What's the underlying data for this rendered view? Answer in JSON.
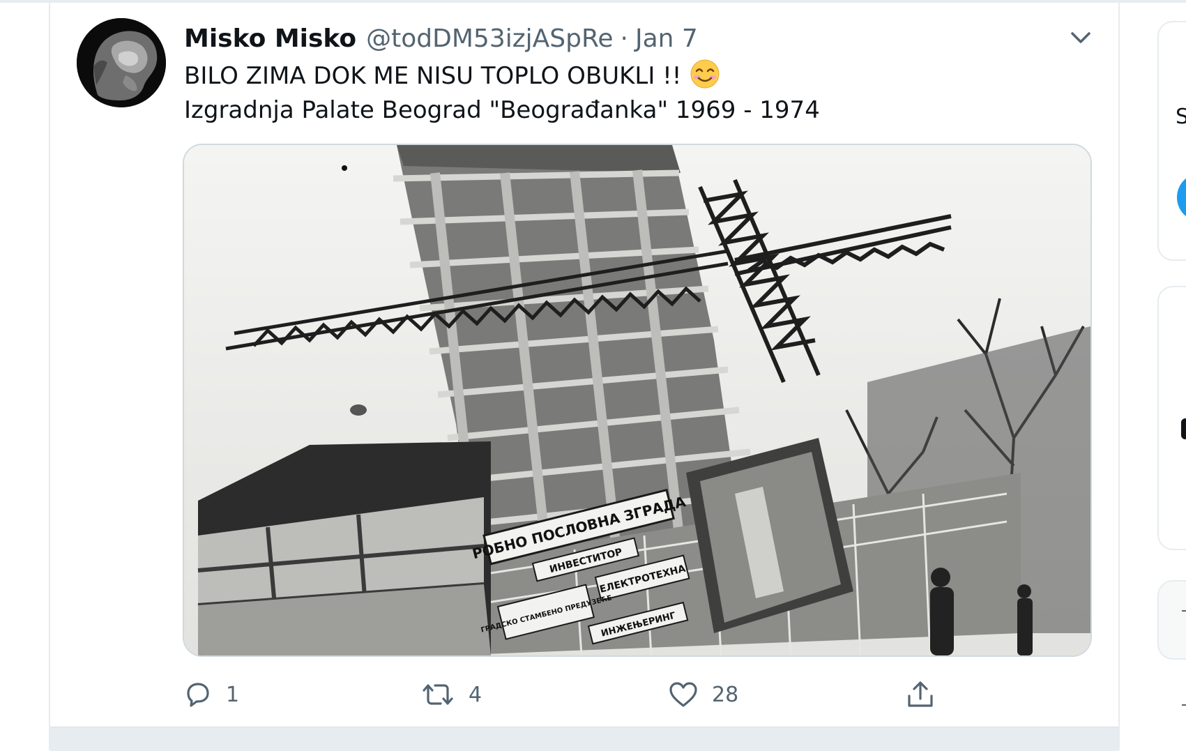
{
  "tweet": {
    "author_name": "Misko Misko",
    "handle": "@todDM53izjASpRe",
    "separator": "·",
    "date": "Jan 7",
    "text_line1": "BILO ZIMA DOK ME NISU TOPLO OBUKLI  !!",
    "text_line2": "Izgradnja Palate Beograd \"Beograđanka\" 1969 - 1974",
    "emoji": "smiling-face-with-blush",
    "media": {
      "sign_main": "РОБНО ПОСЛОВНА ЗГРАДА",
      "sign_sub": "ИНВЕСТИТОР",
      "sign_elektro": "ЕЛЕКТРОТЕХНА",
      "sign_gradsko": "ГРАДСКО СТАМБЕНО ПРЕДУЗЕЋЕ",
      "sign_inzenjering": "ИНЖЕЊЕРИНГ"
    },
    "actions": {
      "reply_count": "1",
      "retweet_count": "4",
      "like_count": "28"
    }
  },
  "sidebar": {
    "partial_letter": "S"
  },
  "colors": {
    "text": "#0f1419",
    "secondary": "#536471",
    "border": "#e6ecf0",
    "accent": "#1d9bf0"
  }
}
